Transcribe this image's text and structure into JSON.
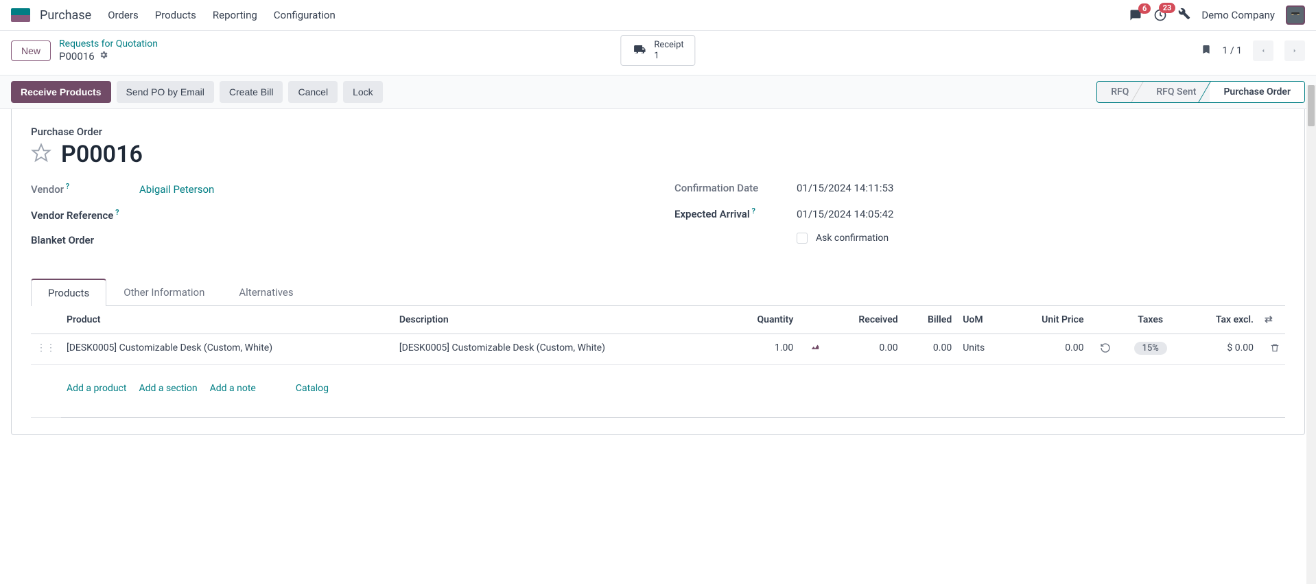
{
  "nav": {
    "app": "Purchase",
    "menu": [
      "Orders",
      "Products",
      "Reporting",
      "Configuration"
    ],
    "chat_badge": "6",
    "activity_badge": "23",
    "company": "Demo Company"
  },
  "cp": {
    "new_btn": "New",
    "bc_parent": "Requests for Quotation",
    "bc_current": "P00016",
    "stat_label": "Receipt",
    "stat_value": "1",
    "pager": "1 / 1"
  },
  "actions": {
    "receive": "Receive Products",
    "send": "Send PO by Email",
    "bill": "Create Bill",
    "cancel": "Cancel",
    "lock": "Lock"
  },
  "status_steps": {
    "s1": "RFQ",
    "s2": "RFQ Sent",
    "s3": "Purchase Order"
  },
  "record": {
    "type": "Purchase Order",
    "name": "P00016",
    "labels": {
      "vendor": "Vendor",
      "vendor_ref": "Vendor Reference",
      "blanket": "Blanket Order",
      "confirm_date": "Confirmation Date",
      "expected": "Expected Arrival",
      "ask_confirm": "Ask confirmation"
    },
    "values": {
      "vendor": "Abigail Peterson",
      "confirm_date": "01/15/2024 14:11:53",
      "expected": "01/15/2024 14:05:42"
    }
  },
  "tabs": {
    "t1": "Products",
    "t2": "Other Information",
    "t3": "Alternatives"
  },
  "table": {
    "headers": {
      "product": "Product",
      "description": "Description",
      "quantity": "Quantity",
      "received": "Received",
      "billed": "Billed",
      "uom": "UoM",
      "unit_price": "Unit Price",
      "taxes": "Taxes",
      "tax_excl": "Tax excl."
    },
    "row": {
      "product": "[DESK0005] Customizable Desk (Custom, White)",
      "description": "[DESK0005] Customizable Desk (Custom, White)",
      "quantity": "1.00",
      "received": "0.00",
      "billed": "0.00",
      "uom": "Units",
      "unit_price": "0.00",
      "taxes": "15%",
      "tax_excl": "$ 0.00"
    },
    "footer": {
      "add_product": "Add a product",
      "add_section": "Add a section",
      "add_note": "Add a note",
      "catalog": "Catalog"
    }
  }
}
